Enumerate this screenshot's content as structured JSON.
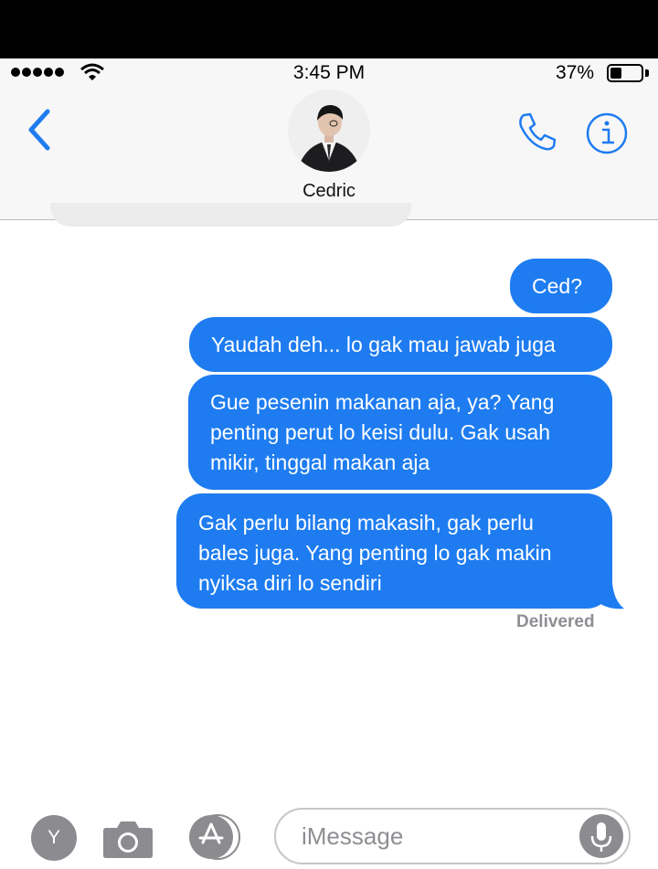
{
  "status_bar": {
    "time": "3:45 PM",
    "battery_percent": "37%",
    "battery_level": 0.37
  },
  "header": {
    "contact_name": "Cedric"
  },
  "messages": [
    {
      "text": "Ced?"
    },
    {
      "text": "Yaudah deh... lo gak mau jawab juga"
    },
    {
      "text": "Gue pesenin makanan aja, ya? Yang\npenting perut lo keisi dulu. Gak usah\nmikir, tinggal makan aja"
    },
    {
      "text": "Gak perlu bilang makasih, gak perlu\nbales juga. Yang penting lo gak makin\nnyiksa diri lo sendiri"
    }
  ],
  "delivery_status": "Delivered",
  "input_bar": {
    "app_button_letter": "Y",
    "placeholder": "iMessage"
  },
  "colors": {
    "bubble": "#1e7cf0",
    "accent": "#1e7cf0"
  },
  "icons": [
    "signal-dots-icon",
    "wifi-icon",
    "battery-icon",
    "back-chevron-icon",
    "phone-icon",
    "info-icon",
    "camera-icon",
    "app-store-icon",
    "microphone-icon"
  ]
}
